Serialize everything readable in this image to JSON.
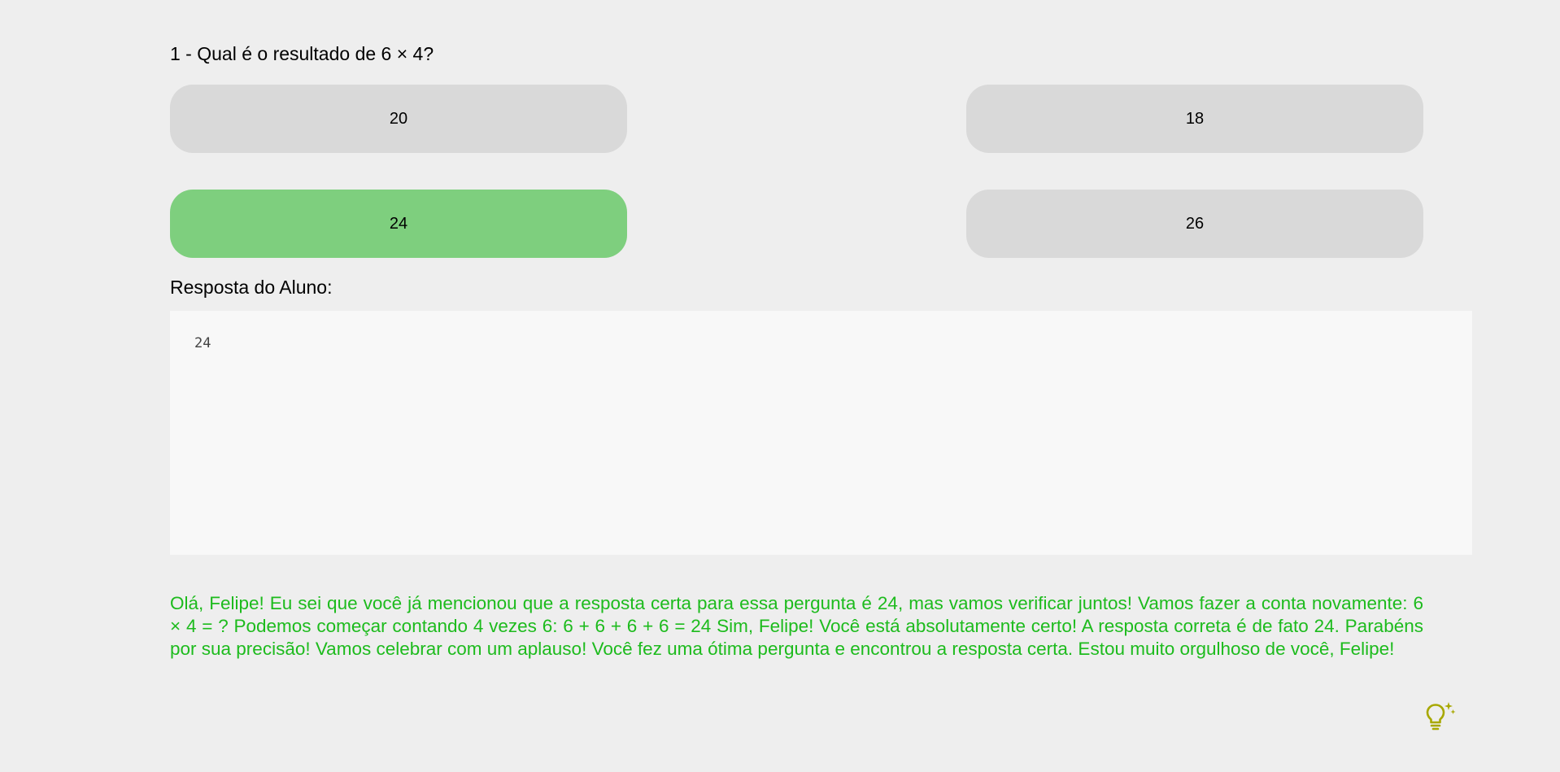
{
  "question": {
    "title": "1 - Qual é o resultado de 6 × 4?"
  },
  "options": [
    {
      "label": "20",
      "selected": false
    },
    {
      "label": "18",
      "selected": false
    },
    {
      "label": "24",
      "selected": true
    },
    {
      "label": "26",
      "selected": false
    }
  ],
  "answer": {
    "label": "Resposta do Aluno:",
    "value": "24"
  },
  "feedback": {
    "text": "Olá, Felipe! Eu sei que você já mencionou que a resposta certa para essa pergunta é 24, mas vamos verificar juntos! Vamos fazer a conta novamente: 6 × 4 = ? Podemos começar contando 4 vezes 6: 6 + 6 + 6 + 6 = 24 Sim, Felipe! Você está absolutamente certo! A resposta correta é de fato 24. Parabéns por sua precisão! Vamos celebrar com um aplauso! Você fez uma ótima pergunta e encontrou a resposta certa. Estou muito orgulhoso de você, Felipe!"
  },
  "hint": {
    "icon": "lightbulb-sparkle-icon"
  },
  "colors": {
    "background": "#eeeeee",
    "option_default": "#d9d9d9",
    "option_selected": "#7ecf7e",
    "feedback_text": "#1dbb1d",
    "hint_icon": "#a8a800"
  }
}
